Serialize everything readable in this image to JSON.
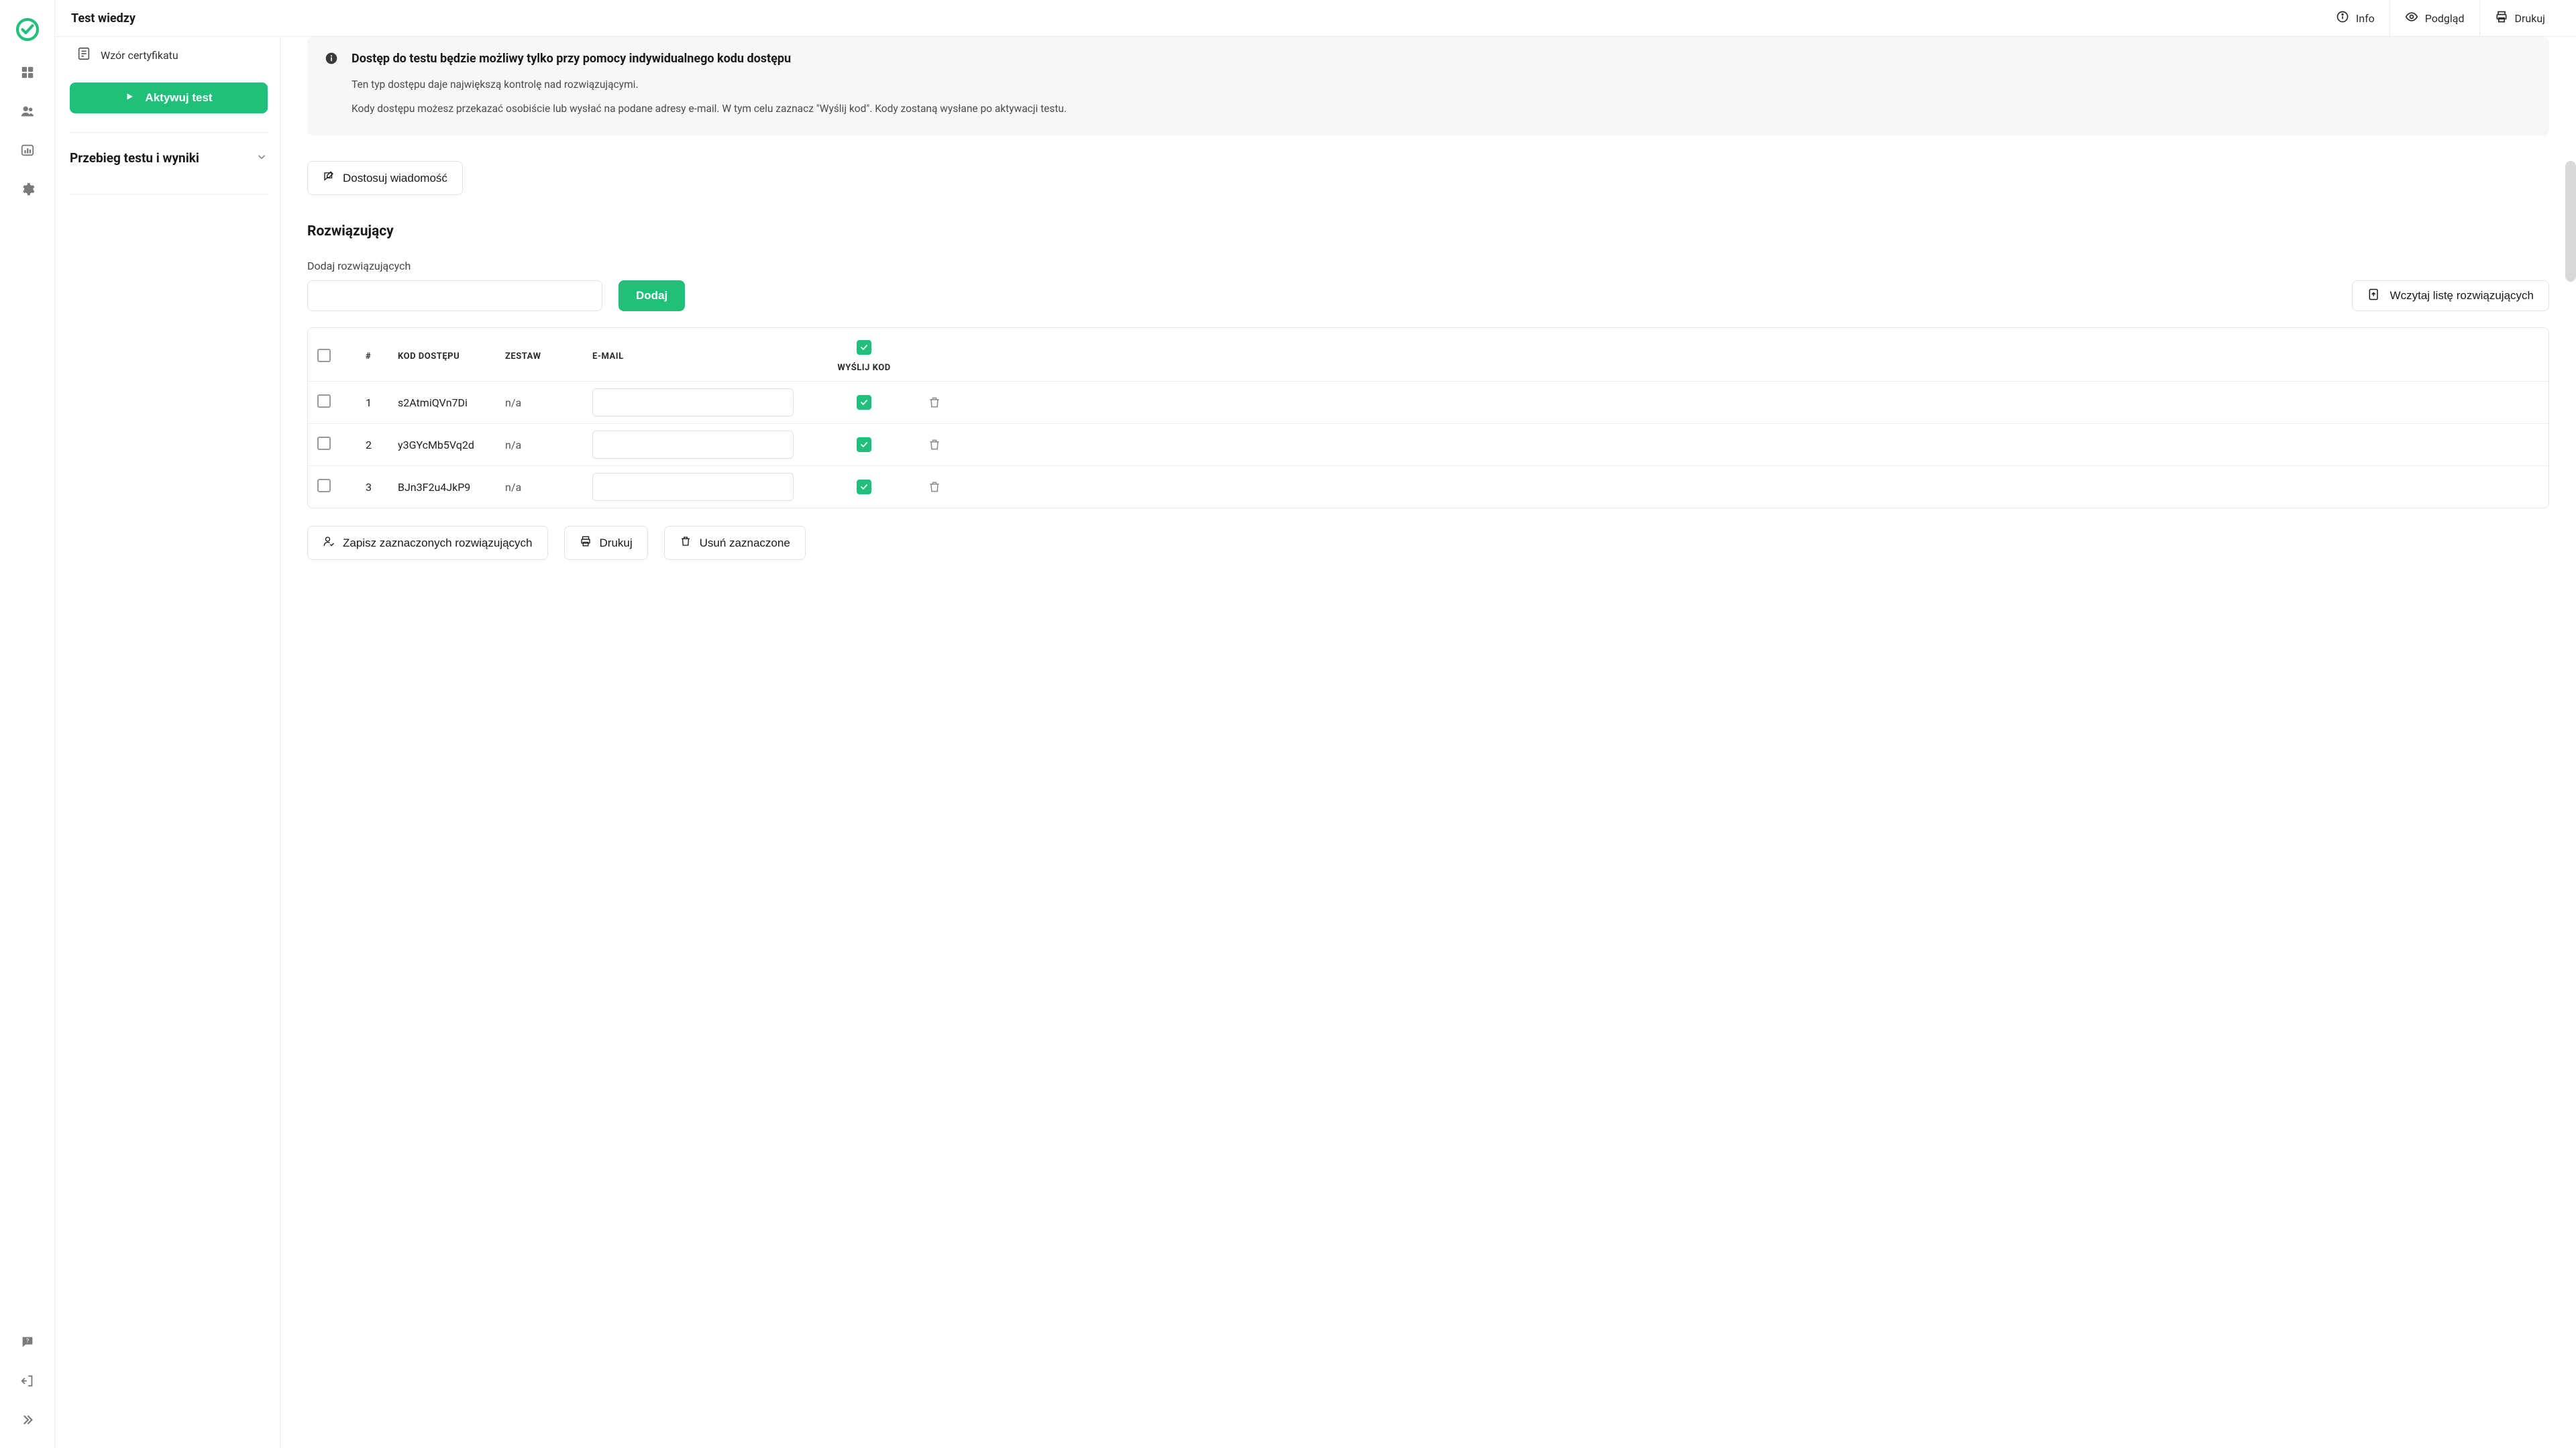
{
  "header": {
    "title": "Test wiedzy",
    "actions": {
      "info": "Info",
      "preview": "Podgląd",
      "print": "Drukuj"
    }
  },
  "sidebar": {
    "cert_template": "Wzór certyfikatu",
    "activate_button": "Aktywuj test",
    "results_section": "Przebieg testu i wyniki"
  },
  "info": {
    "headline": "Dostęp do testu będzie możliwy tylko przy pomocy indywidualnego kodu dostępu",
    "para1": "Ten typ dostępu daje największą kontrolę nad rozwiązującymi.",
    "para2": "Kody dostępu możesz przekazać osobiście lub wysłać na podane adresy e-mail. W tym celu zaznacz \"Wyślij kod\". Kody zostaną wysłane po aktywacji testu."
  },
  "customize_message_button": "Dostosuj wiadomość",
  "solvers": {
    "title": "Rozwiązujący",
    "add_label": "Dodaj rozwiązujących",
    "add_button": "Dodaj",
    "upload_button": "Wczytaj listę rozwiązujących",
    "columns": {
      "idx": "#",
      "code": "KOD DOSTĘPU",
      "set": "ZESTAW",
      "email": "E-MAIL",
      "send": "WYŚLIJ KOD"
    },
    "rows": [
      {
        "idx": "1",
        "code": "s2AtmiQVn7Di",
        "set": "n/a",
        "email": "",
        "send": true
      },
      {
        "idx": "2",
        "code": "y3GYcMb5Vq2d",
        "set": "n/a",
        "email": "",
        "send": true
      },
      {
        "idx": "3",
        "code": "BJn3F2u4JkP9",
        "set": "n/a",
        "email": "",
        "send": true
      }
    ]
  },
  "bottom_actions": {
    "save": "Zapisz zaznaczonych rozwiązujących",
    "print": "Drukuj",
    "delete": "Usuń zaznaczone"
  },
  "colors": {
    "accent": "#21c07a"
  }
}
